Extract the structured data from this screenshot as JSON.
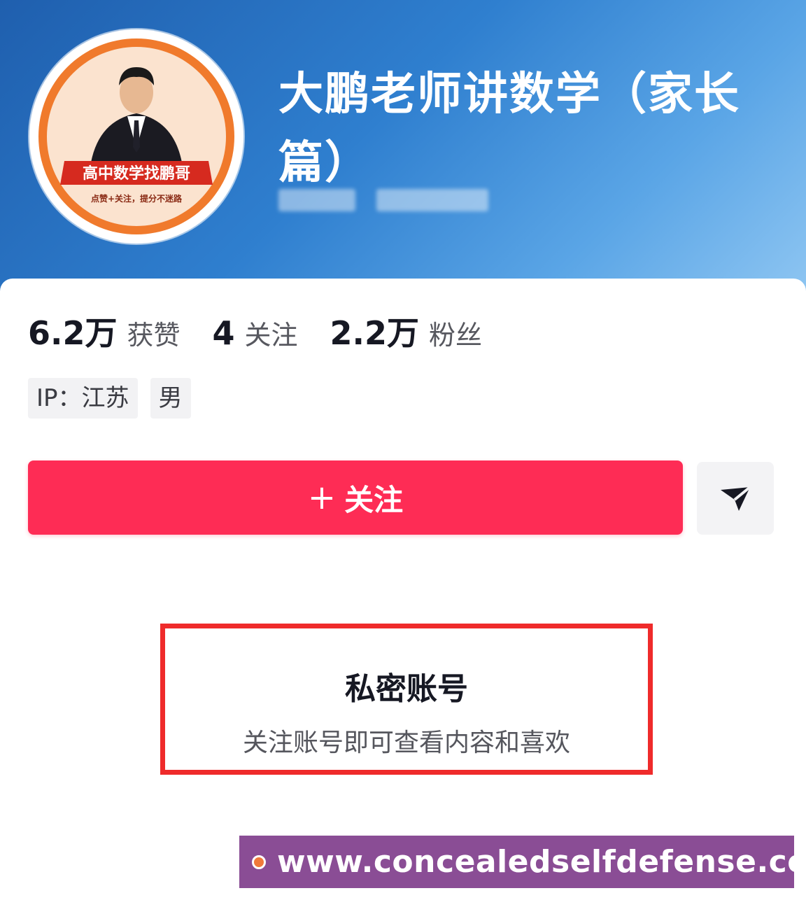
{
  "profile": {
    "name": "大鹏老师讲数学（家长篇）",
    "avatar_label": "高中数学找鹏哥",
    "avatar_caption": "点赞+关注，提分不迷路"
  },
  "stats": [
    {
      "value": "6.2万",
      "label": "获赞"
    },
    {
      "value": "4",
      "label": "关注"
    },
    {
      "value": "2.2万",
      "label": "粉丝"
    }
  ],
  "tags": [
    "IP：江苏",
    "男"
  ],
  "actions": {
    "follow_plus": "+",
    "follow_label": "关注",
    "share_icon": "send-icon"
  },
  "private_notice": {
    "title": "私密账号",
    "subtitle": "关注账号即可查看内容和喜欢"
  },
  "watermark": {
    "text": "www.concealedselfdefense.com"
  },
  "colors": {
    "follow_button": "#fe2c55",
    "highlight_border": "#ef2b2b",
    "watermark_bg": "#8a4d95",
    "header_blue": "#2f7fcf"
  }
}
